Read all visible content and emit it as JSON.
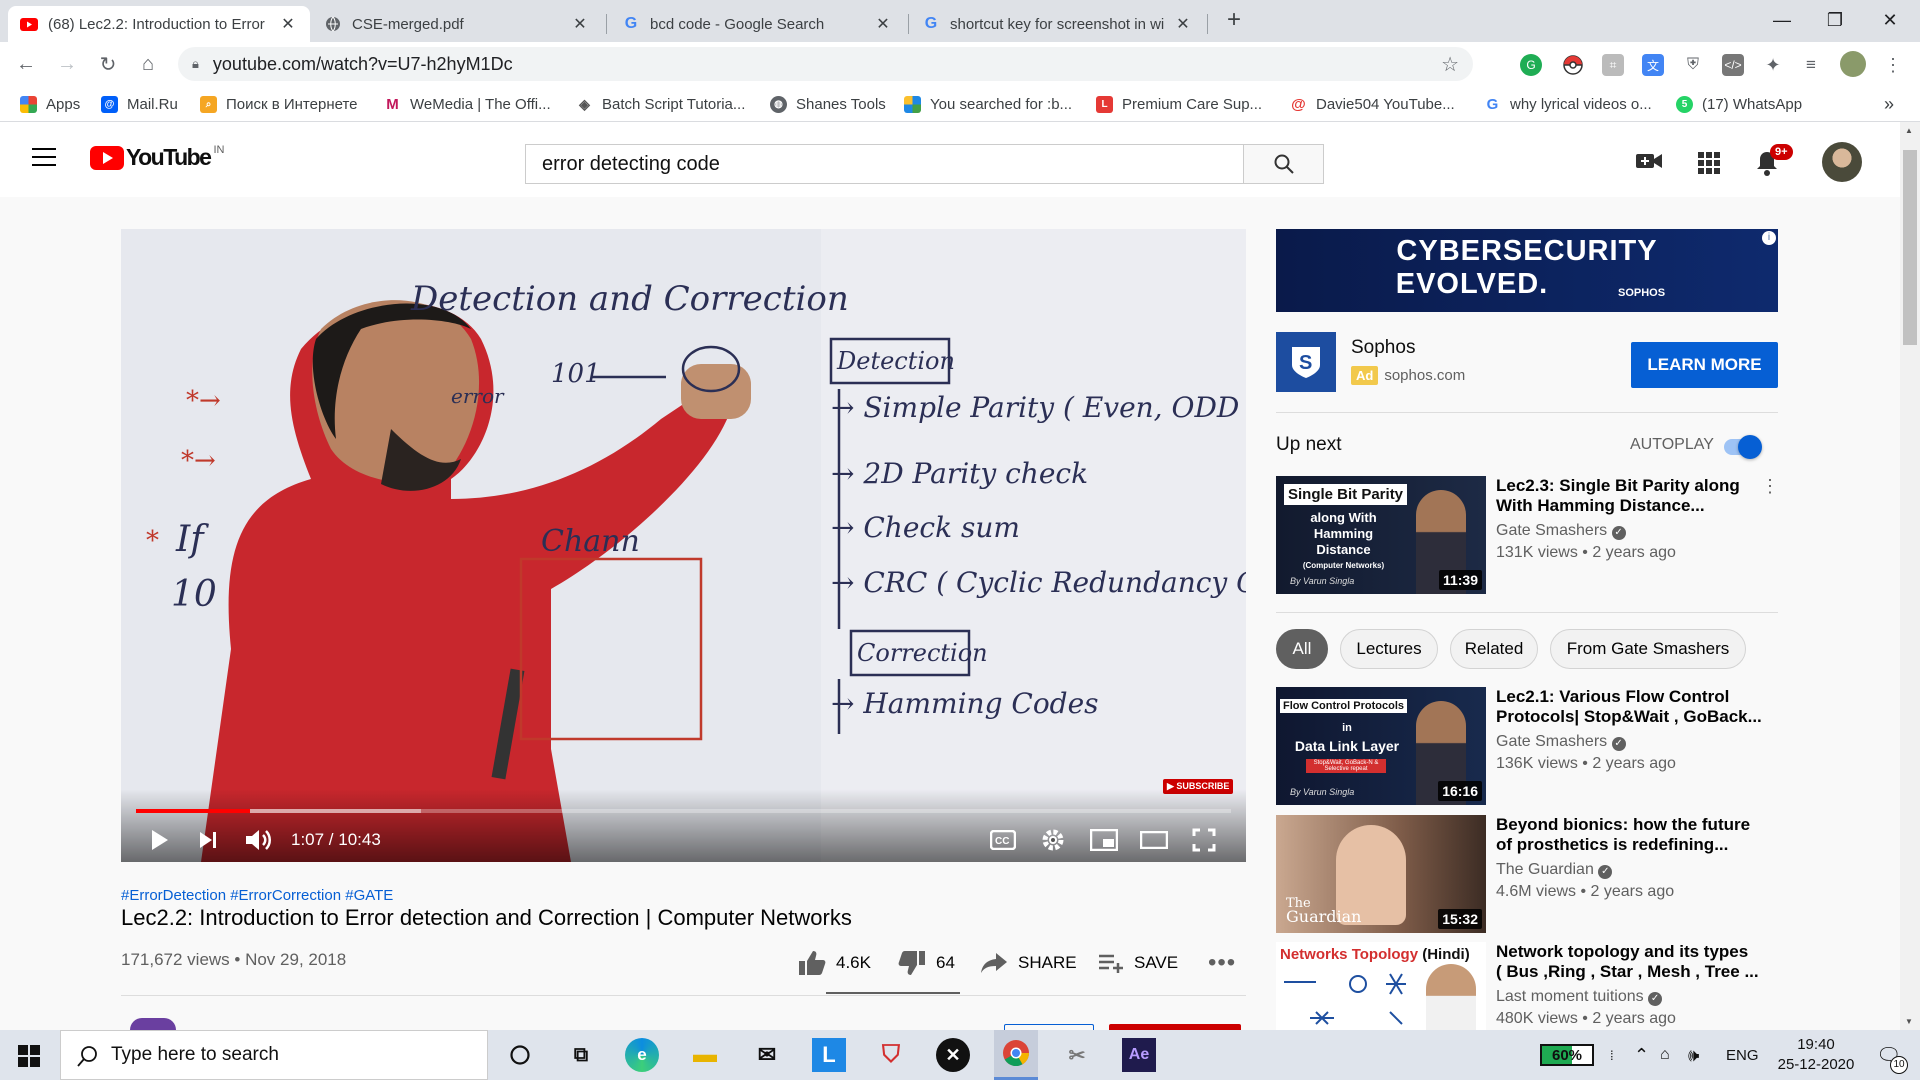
{
  "browser": {
    "tabs": [
      {
        "title": "(68) Lec2.2: Introduction to Error",
        "icon": "youtube-icon",
        "active": true
      },
      {
        "title": "CSE-merged.pdf",
        "icon": "globe-icon"
      },
      {
        "title": "bcd code - Google Search",
        "icon": "google-icon"
      },
      {
        "title": "shortcut key for screenshot in wi",
        "icon": "google-icon"
      }
    ],
    "url": "youtube.com/watch?v=U7-h2hyM1Dc",
    "bookmarks": [
      {
        "label": "Apps"
      },
      {
        "label": "Mail.Ru"
      },
      {
        "label": "Поиск в Интернете"
      },
      {
        "label": "WeMedia | The Offi..."
      },
      {
        "label": "Batch Script Tutoria..."
      },
      {
        "label": "Shanes Tools"
      },
      {
        "label": "You searched for :b..."
      },
      {
        "label": "Premium Care Sup..."
      },
      {
        "label": "Davie504 YouTube..."
      },
      {
        "label": "why lyrical videos o..."
      },
      {
        "label": "(17) WhatsApp"
      }
    ],
    "more_bookmarks": "»"
  },
  "youtube": {
    "logo_text": "YouTube",
    "country": "IN",
    "search_query": "error detecting code",
    "notifications": "9+"
  },
  "video": {
    "time": "1:07 / 10:43",
    "progress": 0.104,
    "buffered": 0.26,
    "hashtags": "#ErrorDetection #ErrorCorrection #GATE",
    "title": "Lec2.2: Introduction to Error detection and Correction | Computer Networks",
    "meta": "171,672 views • Nov 29, 2018",
    "likes": "4.6K",
    "dislikes": "64",
    "share": "SHARE",
    "save": "SAVE",
    "subscribe_watermark": "SUBSCRIBE",
    "board": {
      "heading": "Detection and Correction",
      "detection_box": "Detection",
      "items": [
        "Simple Parity ( Even, ODD )",
        "2D Parity check",
        "Check sum",
        "CRC ( Cyclic Redundancy Check)"
      ],
      "correction_box": "Correction",
      "correction_item": "Hamming Codes",
      "left_fragments": [
        "101",
        "error",
        "If",
        "10",
        "Chann"
      ]
    }
  },
  "ad": {
    "banner_line1": "CYBERSECURITY",
    "banner_line2": "EVOLVED.",
    "banner_brand": "SOPHOS",
    "advertiser": "Sophos",
    "badge": "Ad",
    "domain": "sophos.com",
    "cta": "LEARN MORE"
  },
  "sidebar": {
    "up_next": "Up next",
    "autoplay": "AUTOPLAY",
    "chips": [
      "All",
      "Lectures",
      "Related",
      "From Gate Smashers"
    ],
    "videos": [
      {
        "title1": "Lec2.3: Single Bit Parity along",
        "title2": "With Hamming Distance...",
        "channel": "Gate Smashers",
        "meta": "131K views • 2 years ago",
        "duration": "11:39",
        "thumb_text1": "Single Bit Parity",
        "thumb_text2": "along With",
        "thumb_text3": "Hamming Distance",
        "thumb_text4": "(Computer Networks)",
        "thumb_sig": "By Varun Singla"
      },
      {
        "title1": "Lec2.1: Various Flow Control",
        "title2": "Protocols| Stop&Wait , GoBack...",
        "channel": "Gate Smashers",
        "meta": "136K views • 2 years ago",
        "duration": "16:16",
        "thumb_text1": "Flow Control Protocols",
        "thumb_text2": "in",
        "thumb_text3": "Data Link Layer",
        "thumb_text4": "Stop&Wait, GoBack-N & Selective repeat",
        "thumb_sig": "By Varun Singla"
      },
      {
        "title1": "Beyond bionics: how the future",
        "title2": "of prosthetics is redefining...",
        "channel": "The Guardian",
        "meta": "4.6M views • 2 years ago",
        "duration": "15:32",
        "thumb_text1": "The",
        "thumb_text2": "Guardian"
      },
      {
        "title1": "Network topology and its types",
        "title2": "( Bus ,Ring , Star , Mesh , Tree ...",
        "channel": "Last moment tuitions",
        "meta": "480K views • 2 years ago",
        "thumb_text1": "Networks Topology",
        "thumb_text2": "(Hindi)"
      }
    ]
  },
  "taskbar": {
    "search_placeholder": "Type here to search",
    "battery": "60%",
    "language": "ENG",
    "time": "19:40",
    "date": "25-12-2020",
    "notif_count": "10"
  }
}
